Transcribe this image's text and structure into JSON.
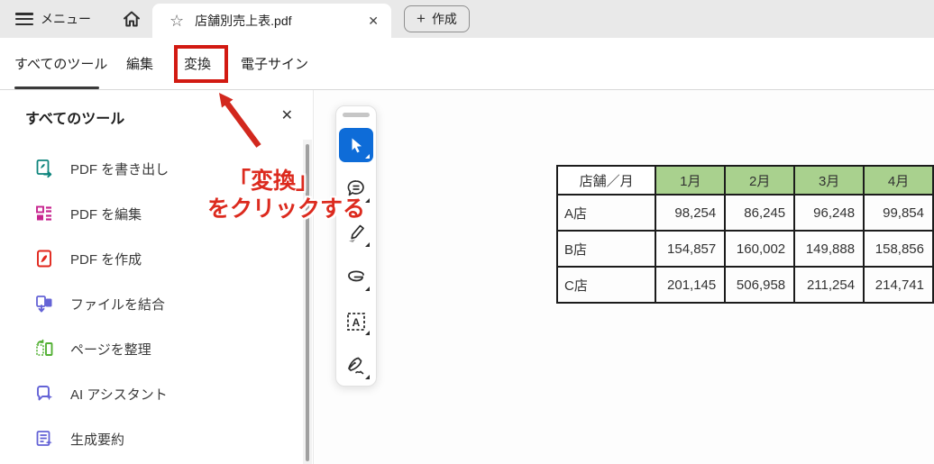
{
  "colors": {
    "highlight_red": "#D21A12",
    "annotation_text_red": "#DC2A1E",
    "table_header_green": "#A9D18E",
    "select_tool_blue": "#0E6CD8",
    "topbar_gray": "#E9E9E9"
  },
  "top_bar": {
    "menu_label": "メニュー",
    "tab": {
      "title": "店舗別売上表.pdf"
    },
    "create_button_label": "作成",
    "glyphs": {
      "star": "☆",
      "close": "✕",
      "plus": "+"
    }
  },
  "ribbon": {
    "tabs": [
      {
        "label": "すべてのツール",
        "active": true
      },
      {
        "label": "編集",
        "active": false
      },
      {
        "label": "変換",
        "active": false,
        "highlighted": true
      },
      {
        "label": "電子サイン",
        "active": false
      }
    ]
  },
  "annotation": {
    "line1": "「変換」",
    "line2": "をクリックする"
  },
  "sidebar": {
    "title": "すべてのツール",
    "close_glyph": "✕",
    "items": [
      {
        "label": "PDF を書き出し",
        "icon": "export-pdf-icon",
        "color": "#0E857D"
      },
      {
        "label": "PDF を編集",
        "icon": "edit-pdf-icon",
        "color": "#C7258F"
      },
      {
        "label": "PDF を作成",
        "icon": "create-pdf-icon",
        "color": "#E1251B"
      },
      {
        "label": "ファイルを結合",
        "icon": "combine-files-icon",
        "color": "#6463D6"
      },
      {
        "label": "ページを整理",
        "icon": "organize-pages-icon",
        "color": "#53B034"
      },
      {
        "label": "AI アシスタント",
        "icon": "ai-assistant-icon",
        "color": "#6463D6"
      },
      {
        "label": "生成要約",
        "icon": "generative-summary-icon",
        "color": "#6463D6"
      }
    ]
  },
  "quick_tools": [
    {
      "name": "select",
      "active": true
    },
    {
      "name": "comment",
      "active": false
    },
    {
      "name": "draw",
      "active": false
    },
    {
      "name": "lasso",
      "active": false
    },
    {
      "name": "add-text",
      "active": false
    },
    {
      "name": "sign",
      "active": false
    }
  ],
  "document_table": {
    "headers": [
      "店舗／月",
      "1月",
      "2月",
      "3月",
      "4月"
    ],
    "rows": [
      {
        "store": "A店",
        "values": [
          "98,254",
          "86,245",
          "96,248",
          "99,854"
        ]
      },
      {
        "store": "B店",
        "values": [
          "154,857",
          "160,002",
          "149,888",
          "158,856"
        ]
      },
      {
        "store": "C店",
        "values": [
          "201,145",
          "506,958",
          "211,254",
          "214,741"
        ]
      }
    ]
  }
}
